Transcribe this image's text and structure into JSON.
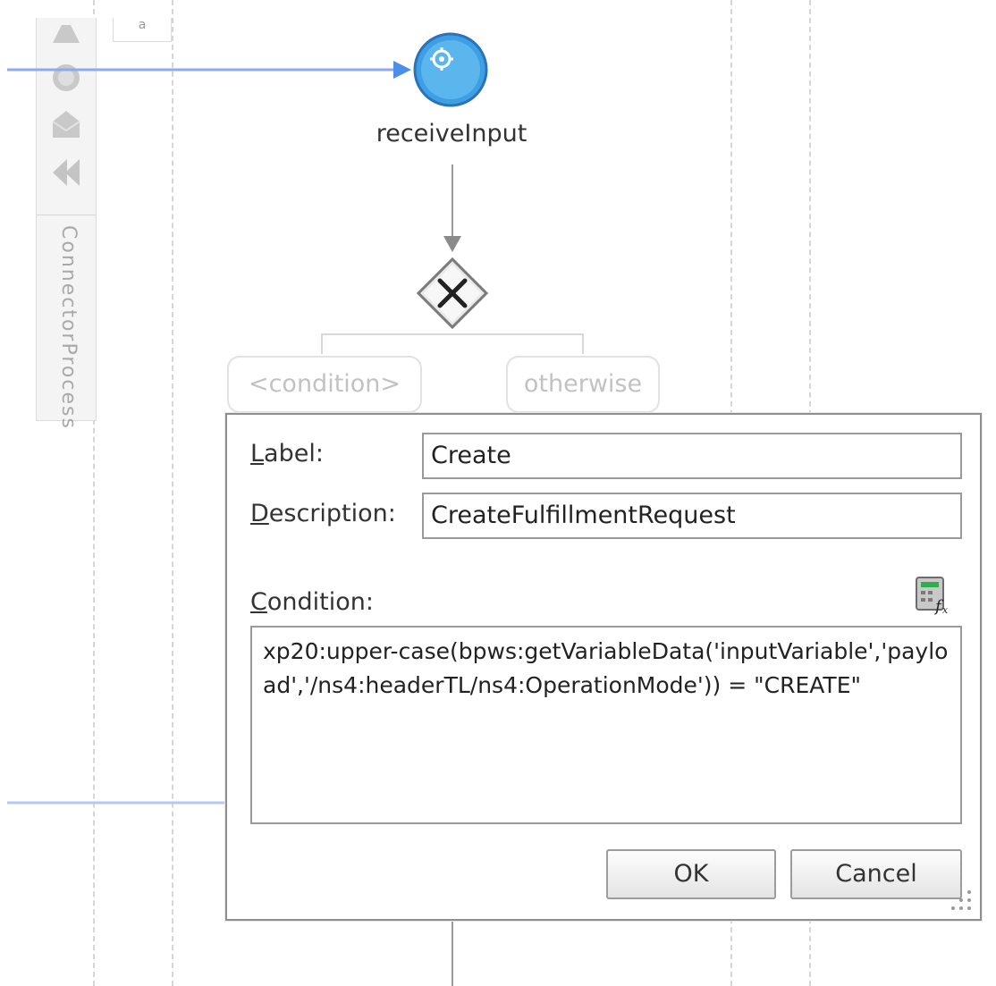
{
  "top_tab": {
    "label": "a"
  },
  "palette": {
    "title": "ConnectorProcess",
    "icons": [
      "receive-icon",
      "timer-icon",
      "message-icon",
      "rewind-icon"
    ]
  },
  "flow": {
    "start_node": {
      "label": "receiveInput",
      "icon": "gear-icon"
    },
    "gateway": {
      "icon": "exclusive-gateway-x-icon"
    },
    "branches": [
      {
        "label": "<condition>"
      },
      {
        "label": "otherwise"
      }
    ]
  },
  "dialog": {
    "label_field": {
      "mnemonic": "L",
      "rest": "abel:",
      "value": "Create"
    },
    "description_field": {
      "mnemonic": "D",
      "rest": "escription:",
      "value": "CreateFulfillmentRequest"
    },
    "condition_field": {
      "mnemonic": "C",
      "rest": "ondition:",
      "value": "xp20:upper-case(bpws:getVariableData('inputVariable','payload','/ns4:headerTL/ns4:OperationMode')) = \"CREATE\""
    },
    "expression_builder_icon": "expression-builder-icon",
    "buttons": {
      "ok": "OK",
      "cancel": "Cancel"
    }
  },
  "colors": {
    "connector": "#8fa8f0",
    "start_node": "#4aa8e6",
    "dialog_border": "#8f8f8f"
  }
}
